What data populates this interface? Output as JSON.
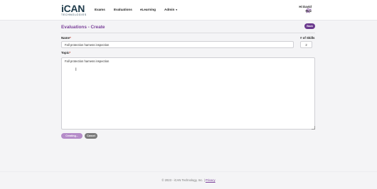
{
  "nav": {
    "logo_text": "iCAN",
    "logo_subtext": "TECHNOLOGIES",
    "items": [
      "Exams",
      "Evaluations",
      "eLearning",
      "Admin"
    ],
    "user_greeting": "Hi David",
    "user_name": "Max"
  },
  "page": {
    "title": "Evaluations - Create",
    "back_label": "Back"
  },
  "form": {
    "name_label": "Name",
    "name_value": "Fall protection harness inspection",
    "skills_label": "# of Skills",
    "skills_value": "2",
    "topic_label": "Topic",
    "topic_value": "Fall protection harness inspection",
    "create_label": "Creating...",
    "cancel_label": "Cancel"
  },
  "footer": {
    "copyright": "© 2023 - iCAN Technology, Inc. |",
    "privacy_label": "Privacy"
  },
  "colors": {
    "accent": "#7a3f99",
    "back_button": "#6b3a8e",
    "create_button": "#b58cc9",
    "cancel_button": "#7a7a7a"
  }
}
